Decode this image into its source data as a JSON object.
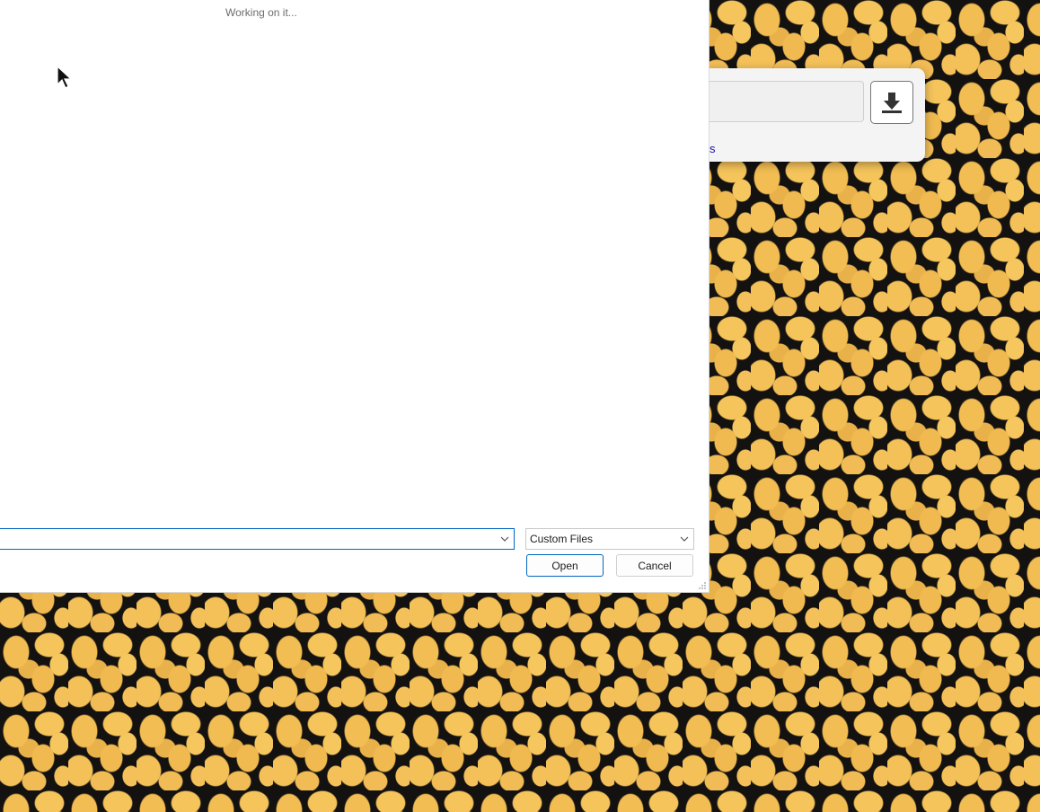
{
  "dialog": {
    "status_text": "Working on it...",
    "filename_value": "",
    "filter_selected": "Custom Files",
    "open_label": "Open",
    "cancel_label": "Cancel"
  },
  "background_window": {
    "link_fragment": "s"
  },
  "colors": {
    "accent": "#0067c0",
    "wallpaper_spot": "#f2bd52",
    "wallpaper_bg": "#141210"
  }
}
